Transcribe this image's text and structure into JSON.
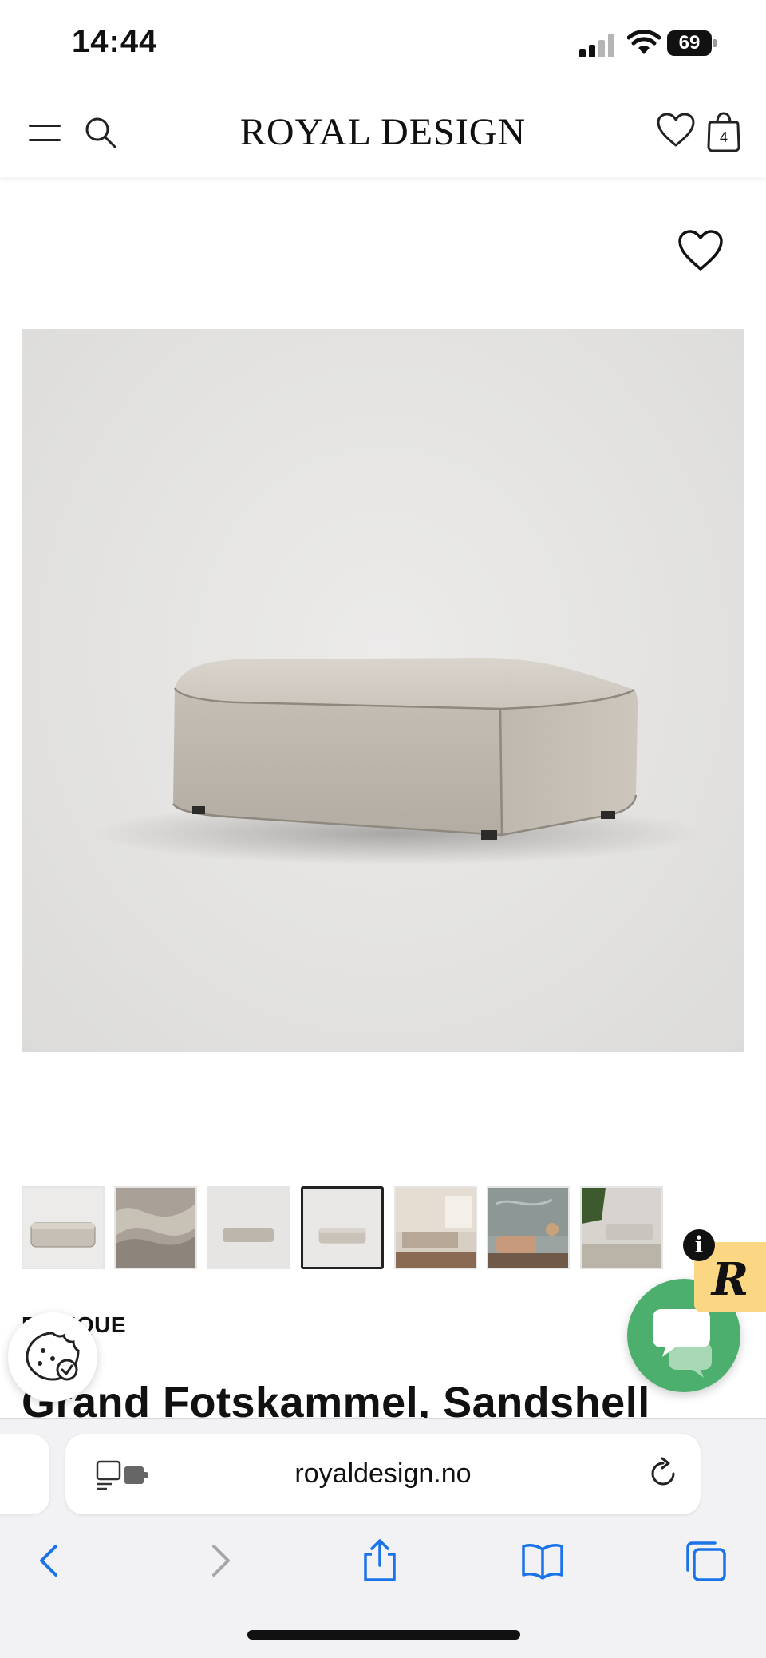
{
  "status_bar": {
    "time": "14:44",
    "battery": "69"
  },
  "header": {
    "logo": "ROYAL DESIGN",
    "cart_count": "4"
  },
  "product": {
    "brand": "BOTIQUE",
    "title": "Grand Fotskammel, Sandshell",
    "thumbnail_count": 7,
    "active_thumbnail": 4
  },
  "widgets": {
    "reviews_letter": "R",
    "info": "i"
  },
  "browser": {
    "url": "royaldesign.no"
  },
  "colors": {
    "chat_green": "#4caf6e",
    "reviews_yellow": "#fbd683",
    "safari_blue": "#1a73e8"
  }
}
